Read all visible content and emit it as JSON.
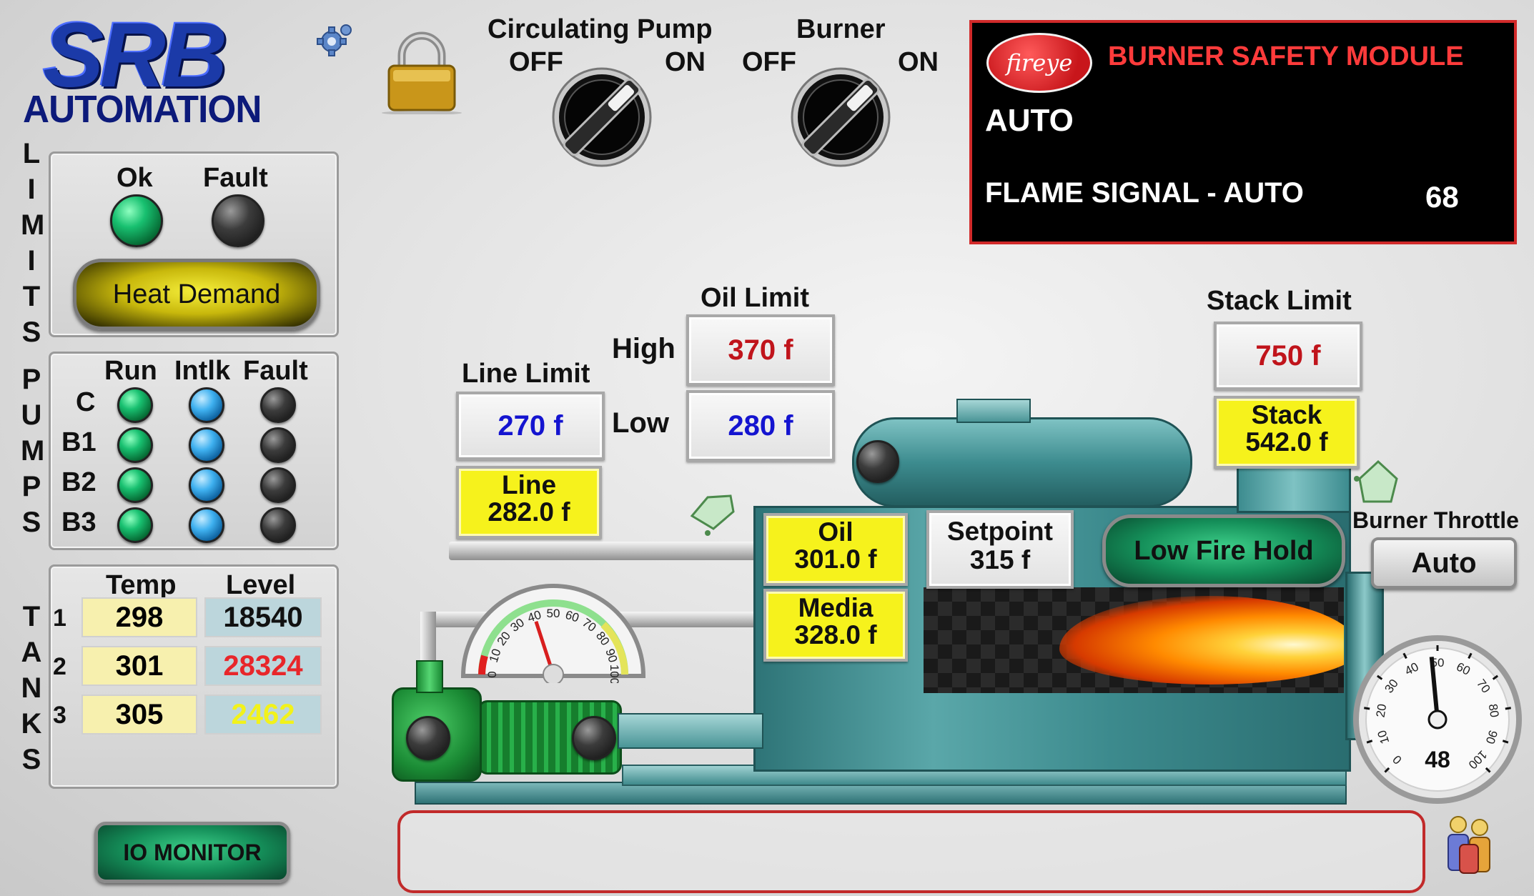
{
  "brand": {
    "logo_top": "SRB",
    "logo_bottom": "AUTOMATION"
  },
  "limits": {
    "side_label": "LIMITS",
    "ok_label": "Ok",
    "fault_label": "Fault",
    "heat_demand_label": "Heat Demand"
  },
  "pumps": {
    "side_label": "PUMPS",
    "col_run": "Run",
    "col_intlk": "Intlk",
    "col_fault": "Fault",
    "rows": [
      {
        "label": "C"
      },
      {
        "label": "B1"
      },
      {
        "label": "B2"
      },
      {
        "label": "B3"
      }
    ]
  },
  "tanks": {
    "side_label": "TANKS",
    "col_temp": "Temp",
    "col_level": "Level",
    "rows": [
      {
        "num": "1",
        "temp": "298",
        "level": "18540",
        "level_color": "#111111"
      },
      {
        "num": "2",
        "temp": "301",
        "level": "28324",
        "level_color": "#e8262a"
      },
      {
        "num": "3",
        "temp": "305",
        "level": "2462",
        "level_color": "#f2f21a"
      }
    ]
  },
  "io_monitor_label": "IO MONITOR",
  "switches": {
    "pump_title": "Circulating Pump",
    "burner_title": "Burner",
    "off": "OFF",
    "on": "ON"
  },
  "safety": {
    "brand": "fireye",
    "title": "BURNER SAFETY MODULE",
    "mode": "AUTO",
    "flame_label": "FLAME SIGNAL - AUTO",
    "flame_value": "68"
  },
  "oil_limit": {
    "title": "Oil Limit",
    "high_label": "High",
    "high_value": "370 f",
    "low_label": "Low",
    "low_value": "280 f"
  },
  "line_limit": {
    "title": "Line Limit",
    "value": "270 f",
    "reading_label": "Line",
    "reading_value": "282.0 f"
  },
  "stack_limit": {
    "title": "Stack Limit",
    "value": "750 f",
    "reading_label": "Stack",
    "reading_value": "542.0 f"
  },
  "oil": {
    "label": "Oil",
    "value": "301.0 f"
  },
  "media": {
    "label": "Media",
    "value": "328.0 f"
  },
  "setpoint": {
    "label": "Setpoint",
    "value": "315 f"
  },
  "low_fire_hold_label": "Low Fire Hold",
  "throttle": {
    "title": "Burner Throttle",
    "mode": "Auto",
    "value": "48",
    "level_percent": 48,
    "ticks": [
      "0",
      "10",
      "20",
      "30",
      "40",
      "50",
      "60",
      "70",
      "80",
      "90",
      "100"
    ]
  },
  "pressure_gauge": {
    "ticks": [
      "0",
      "10",
      "20",
      "30",
      "40",
      "50",
      "60",
      "70",
      "80",
      "90",
      "100"
    ],
    "value_percent": 40
  },
  "colors": {
    "limit_high": "#c0141b",
    "limit_low": "#1414d0",
    "reading_bg": "#f6f21c",
    "boiler": "#3f8f92",
    "pump": "#1f9a3a",
    "safety_bg": "#000000",
    "safety_title": "#ff3b3b"
  },
  "message_bar": {
    "text": ""
  }
}
